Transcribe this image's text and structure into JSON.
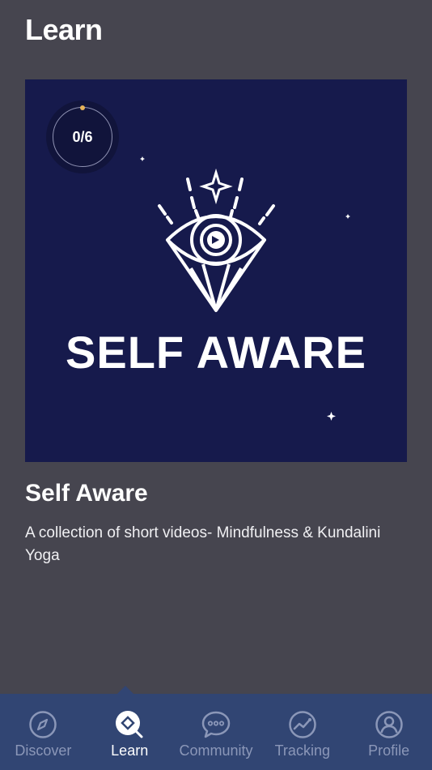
{
  "header": {
    "title": "Learn"
  },
  "course": {
    "art_title": "SELF AWARE",
    "progress": "0/6",
    "title": "Self Aware",
    "description": "A collection of short videos- Mindfulness & Kundalini Yoga"
  },
  "colors": {
    "background": "#46454f",
    "card": "#161a4c",
    "tabbar": "#314573",
    "tab_inactive": "#8b97b8",
    "tab_active": "#ffffff",
    "progress_dot": "#e6b35a"
  },
  "tabs": [
    {
      "label": "Discover",
      "icon": "compass-icon",
      "active": false
    },
    {
      "label": "Learn",
      "icon": "learn-search-icon",
      "active": true
    },
    {
      "label": "Community",
      "icon": "chat-bubble-icon",
      "active": false
    },
    {
      "label": "Tracking",
      "icon": "chart-icon",
      "active": false
    },
    {
      "label": "Profile",
      "icon": "user-icon",
      "active": false
    }
  ]
}
